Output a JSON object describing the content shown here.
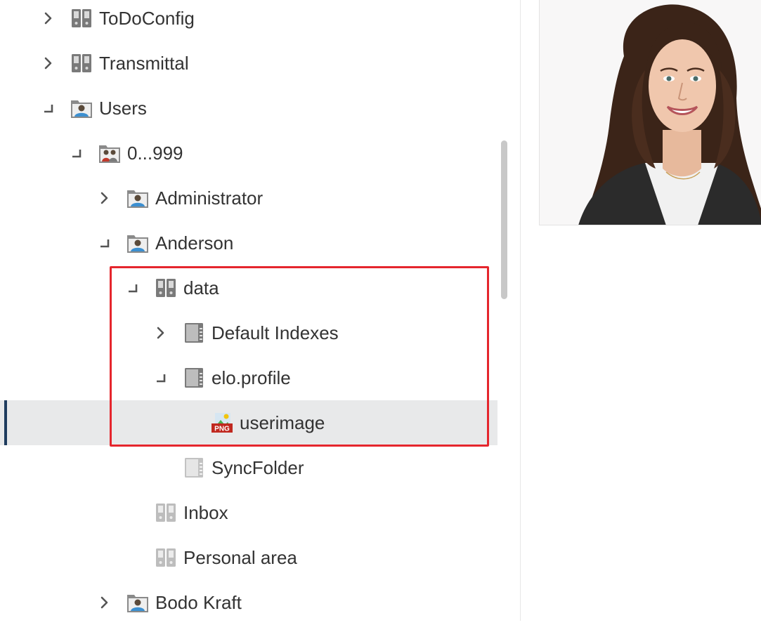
{
  "tree": {
    "nodes": [
      {
        "label": "ToDoConfig",
        "toggle": "expand",
        "icon": "binder-icon",
        "expanded": false
      },
      {
        "label": "Transmittal",
        "toggle": "expand",
        "icon": "binder-icon",
        "expanded": false
      },
      {
        "label": "Users",
        "toggle": "collapse",
        "icon": "user-folder-icon",
        "expanded": true
      },
      {
        "label": "0...999",
        "toggle": "collapse",
        "icon": "users-group-icon",
        "expanded": true
      },
      {
        "label": "Administrator",
        "toggle": "expand",
        "icon": "user-folder-icon",
        "expanded": false
      },
      {
        "label": "Anderson",
        "toggle": "collapse",
        "icon": "user-folder-icon",
        "expanded": true
      },
      {
        "label": "data",
        "toggle": "collapse",
        "icon": "binder-icon",
        "expanded": true
      },
      {
        "label": "Default Indexes",
        "toggle": "expand",
        "icon": "folder-icon",
        "expanded": false
      },
      {
        "label": "elo.profile",
        "toggle": "collapse",
        "icon": "folder-icon",
        "expanded": true
      },
      {
        "label": "userimage",
        "toggle": "none",
        "icon": "png-file-icon",
        "selected": true
      },
      {
        "label": "SyncFolder",
        "toggle": "none",
        "icon": "folder-icon-light"
      },
      {
        "label": "Inbox",
        "toggle": "none",
        "icon": "binder-icon-light"
      },
      {
        "label": "Personal area",
        "toggle": "none",
        "icon": "binder-icon-light"
      },
      {
        "label": "Bodo Kraft",
        "toggle": "expand",
        "icon": "user-folder-icon",
        "expanded": false
      }
    ]
  },
  "preview": {
    "image": "user-portrait-photo"
  },
  "colors": {
    "selection_bg": "#e8e9ea",
    "selection_bar": "#1f3c5e",
    "highlight": "#e5262d",
    "text": "#333333"
  }
}
